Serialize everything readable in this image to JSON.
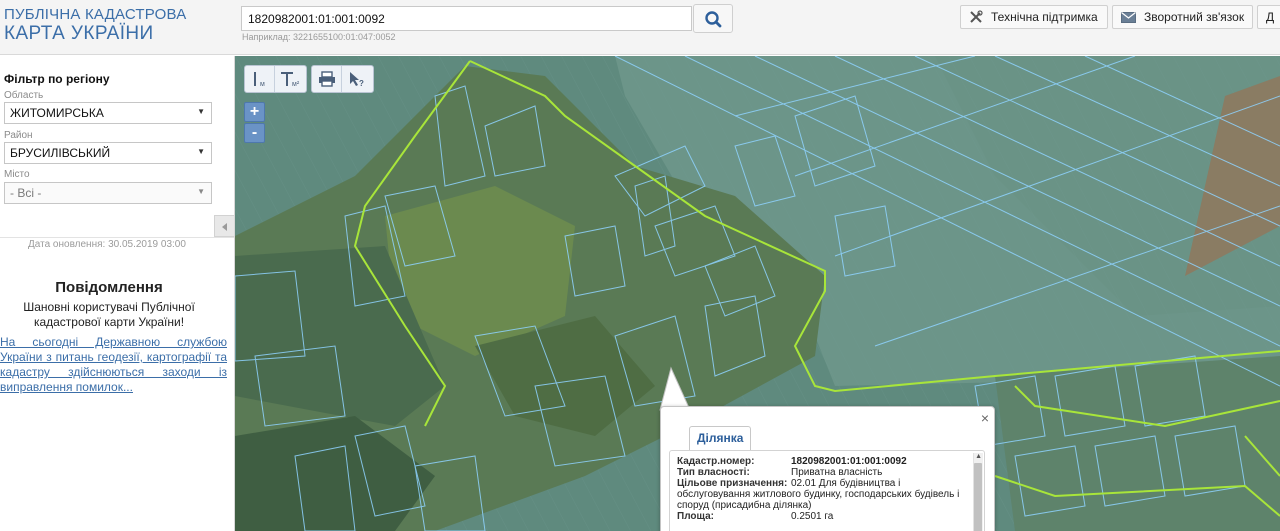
{
  "header": {
    "logo_line1": "ПУБЛІЧНА КАДАСТРОВА",
    "logo_line2": "КАРТА УКРАЇНИ",
    "search_value": "1820982001:01:001:0092",
    "search_hint": "Наприклад: 3221655100:01:047:0052",
    "support_label": "Технічна підтримка",
    "feedback_label": "Зворотний зв'язок",
    "extra_label": "Д"
  },
  "sidebar": {
    "filter_title": "Фільтр по регіону",
    "oblast_label": "Область",
    "oblast_value": "ЖИТОМИРСЬКА",
    "rayon_label": "Район",
    "rayon_value": "БРУСИЛІВСЬКИЙ",
    "misto_label": "Місто",
    "misto_value": "- Всі -",
    "update_date": "Дата оновлення: 30.05.2019 03:00",
    "message_title": "Повідомлення",
    "message_text": "Шановні користувачі Публічної кадастрової карти України!",
    "message_link": "На сьогодні Державною службою України з питань геодезії, картографії та кадастру здійснюються заходи із виправлення помилок..."
  },
  "map": {
    "tools": [
      "measure-length",
      "measure-area",
      "print",
      "identify"
    ],
    "zoom_in": "+",
    "zoom_out": "-"
  },
  "popup": {
    "tab_label": "Ділянка",
    "close": "×",
    "rows": [
      {
        "key": "Кадастр.номер:",
        "value": "1820982001:01:001:0092"
      },
      {
        "key": "Тип власності:",
        "value": "Приватна власність"
      },
      {
        "key": "Цільове призначення:",
        "value": "02.01 Для будівництва і обслуговування житлового будинку, господарських будівель і споруд (присадибна ділянка)"
      },
      {
        "key": "Площа:",
        "value": "0.2501 га"
      }
    ]
  },
  "colors": {
    "brand_blue": "#3b6ea8",
    "parcel_outline": "#7fd0ff",
    "boundary": "#a6e03a"
  }
}
